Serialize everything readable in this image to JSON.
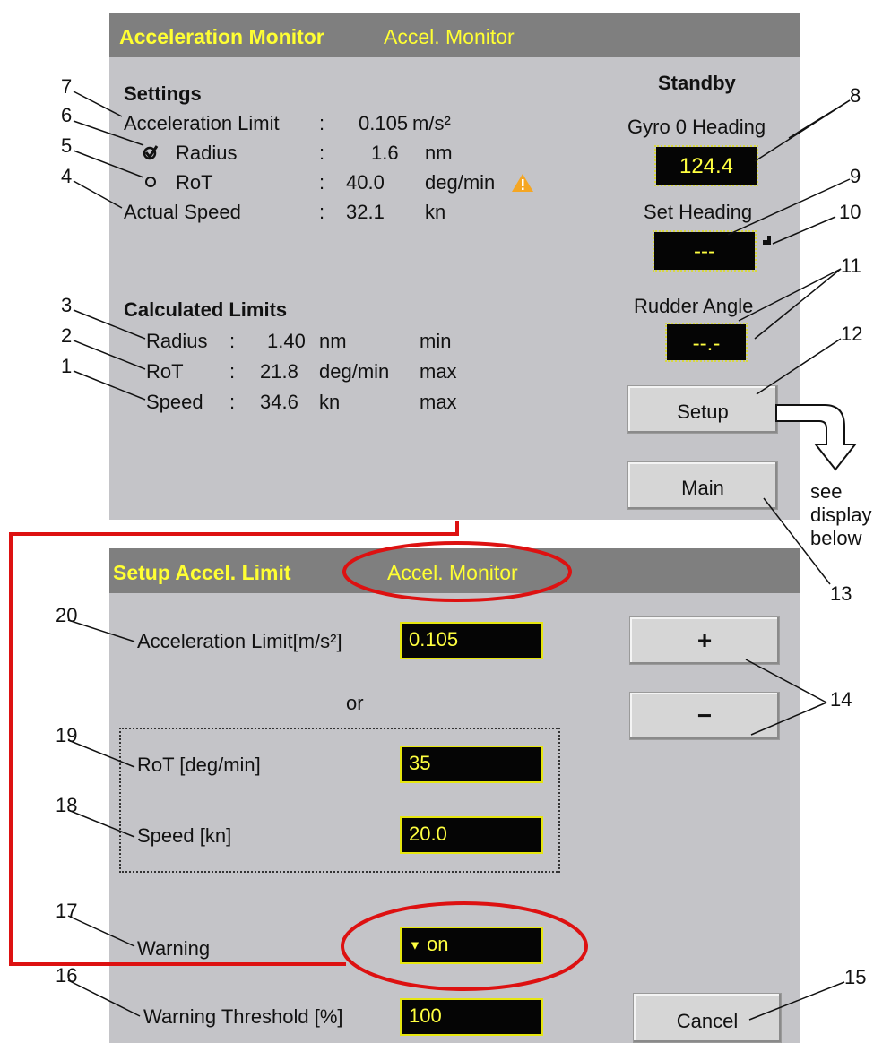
{
  "top_panel": {
    "title": "Acceleration Monitor",
    "subtitle": "Accel. Monitor",
    "settings": {
      "heading": "Settings",
      "accel_label": "Acceleration Limit",
      "accel_sep": ":",
      "accel_value": "0.105",
      "accel_unit": "m/s²",
      "radius_label": "Radius",
      "radius_sep": ":",
      "radius_value": "1.6",
      "radius_unit": "nm",
      "rot_label": "RoT",
      "rot_sep": ":",
      "rot_value": "40.0",
      "rot_unit": "deg/min",
      "speed_label": "Actual Speed",
      "speed_sep": ":",
      "speed_value": "32.1",
      "speed_unit": "kn"
    },
    "calculated": {
      "heading": "Calculated Limits",
      "rows": [
        {
          "label": "Radius",
          "sep": ":",
          "value": "1.40",
          "unit": "nm",
          "qual": "min"
        },
        {
          "label": "RoT",
          "sep": ":",
          "value": "21.8",
          "unit": "deg/min",
          "qual": "max"
        },
        {
          "label": "Speed",
          "sep": ":",
          "value": "34.6",
          "unit": "kn",
          "qual": "max"
        }
      ]
    },
    "right": {
      "mode": "Standby",
      "gyro_label": "Gyro 0 Heading",
      "gyro_value": "124.4",
      "set_heading_label": "Set Heading",
      "set_heading_value": "---",
      "rudder_label": "Rudder Angle",
      "rudder_value": "--.-",
      "setup_button": "Setup",
      "main_button": "Main"
    }
  },
  "bottom_panel": {
    "title": "Setup Accel. Limit",
    "subtitle": "Accel. Monitor",
    "accel_label": "Acceleration Limit[m/s²]",
    "accel_value": "0.105",
    "or_label": "or",
    "rot_label": "RoT [deg/min]",
    "rot_value": "35",
    "speed_label": "Speed [kn]",
    "speed_value": "20.0",
    "warning_label": "Warning",
    "warning_value": "on",
    "threshold_label": "Warning Threshold [%]",
    "threshold_value": "100",
    "plus_button": "+",
    "minus_button": "−",
    "cancel_button": "Cancel"
  },
  "callouts": {
    "n1": "1",
    "n2": "2",
    "n3": "3",
    "n4": "4",
    "n5": "5",
    "n6": "6",
    "n7": "7",
    "n8": "8",
    "n9": "9",
    "n10": "10",
    "n11": "11",
    "n12": "12",
    "n13": "13",
    "n14": "14",
    "n15": "15",
    "n16": "16",
    "n17": "17",
    "n18": "18",
    "n19": "19",
    "n20": "20",
    "see_display_1": "see",
    "see_display_2": "display",
    "see_display_3": "below"
  },
  "colors": {
    "panel_bg": "#c4c4c8",
    "titlebar_bg": "#7f7f7f",
    "title_text": "#ffff33",
    "field_bg": "#050505",
    "field_text": "#ffff40",
    "highlight_red": "#dd1111",
    "warning_icon": "#f5a623"
  },
  "icons": [
    "checked-radio-icon",
    "unchecked-radio-icon",
    "warning-triangle-icon",
    "dropdown-arrow-icon",
    "set-heading-marker-icon",
    "curved-arrow-icon"
  ]
}
